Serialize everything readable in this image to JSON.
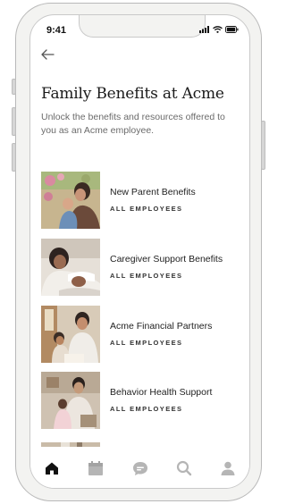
{
  "status_bar": {
    "time": "9:41"
  },
  "header": {
    "title": "Family Benefits at Acme",
    "subtitle": "Unlock the benefits and resources offered to you as an Acme employee."
  },
  "benefits": [
    {
      "title": "New Parent Benefits",
      "audience": "ALL EMPLOYEES"
    },
    {
      "title": "Caregiver Support Benefits",
      "audience": "ALL EMPLOYEES"
    },
    {
      "title": "Acme Financial Partners",
      "audience": "ALL EMPLOYEES"
    },
    {
      "title": "Behavior Health Support",
      "audience": "ALL EMPLOYEES"
    }
  ],
  "tab_bar": {
    "tabs": [
      "home-icon",
      "calendar-icon",
      "chat-icon",
      "search-icon",
      "profile-icon"
    ],
    "active": "home-icon"
  },
  "colors": {
    "active_tab": "#111111",
    "inactive_tab": "#b5b5b5"
  }
}
